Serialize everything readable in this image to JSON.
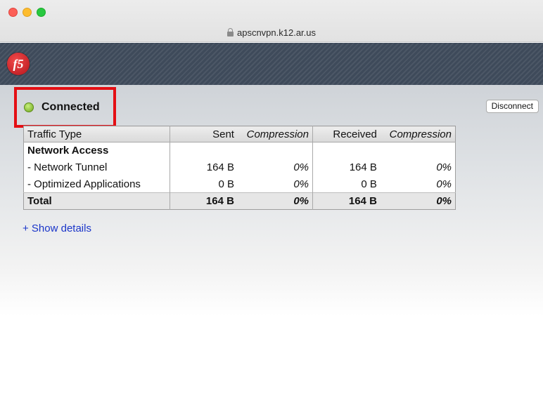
{
  "window": {
    "url": "apscnvpn.k12.ar.us"
  },
  "status": {
    "label": "Connected"
  },
  "disconnect_label": "Disconnect",
  "table": {
    "headers": [
      "Traffic Type",
      "Sent",
      "Compression",
      "Received",
      "Compression"
    ],
    "section": "Network Access",
    "rows": [
      {
        "type": "- Network Tunnel",
        "sent": "164 B",
        "sent_comp": "0%",
        "received": "164 B",
        "received_comp": "0%"
      },
      {
        "type": "- Optimized Applications",
        "sent": "0 B",
        "sent_comp": "0%",
        "received": "0 B",
        "received_comp": "0%"
      }
    ],
    "total": {
      "type": "Total",
      "sent": "164 B",
      "sent_comp": "0%",
      "received": "164 B",
      "received_comp": "0%"
    }
  },
  "show_details_label": "+ Show details",
  "colors": {
    "highlight_border": "#e40f14",
    "status_green": "#6ea51e",
    "link_blue": "#1a35c9",
    "f5_red": "#b5131b"
  },
  "icons": {
    "logo": "f5-logo",
    "lock": "lock-icon",
    "status": "green-status-dot"
  }
}
